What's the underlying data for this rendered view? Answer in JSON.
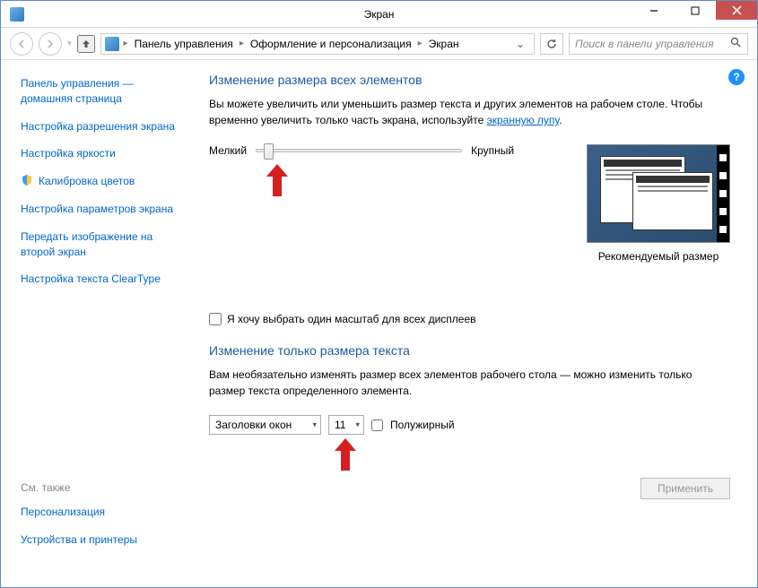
{
  "window": {
    "title": "Экран"
  },
  "breadcrumb": {
    "items": [
      "Панель управления",
      "Оформление и персонализация",
      "Экран"
    ]
  },
  "search": {
    "placeholder": "Поиск в панели управления"
  },
  "sidebar": {
    "items": [
      {
        "label": "Панель управления — домашняя страница",
        "shield": false
      },
      {
        "label": "Настройка разрешения экрана",
        "shield": false
      },
      {
        "label": "Настройка яркости",
        "shield": false
      },
      {
        "label": "Калибровка цветов",
        "shield": true
      },
      {
        "label": "Настройка параметров экрана",
        "shield": false
      },
      {
        "label": "Передать изображение на второй экран",
        "shield": false
      },
      {
        "label": "Настройка текста ClearType",
        "shield": false
      }
    ],
    "see_also_heading": "См. также",
    "see_also": [
      {
        "label": "Персонализация"
      },
      {
        "label": "Устройства и принтеры"
      }
    ]
  },
  "content": {
    "section1": {
      "heading": "Изменение размера всех элементов",
      "body_prefix": "Вы можете увеличить или уменьшить размер текста и других элементов на рабочем столе. Чтобы временно увеличить только часть экрана, используйте ",
      "body_link": "экранную лупу",
      "body_suffix": ".",
      "slider_min_label": "Мелкий",
      "slider_max_label": "Крупный",
      "preview_caption": "Рекомендуемый размер"
    },
    "checkbox_label": "Я хочу выбрать один масштаб для всех дисплеев",
    "section2": {
      "heading": "Изменение только размера текста",
      "body": "Вам необязательно изменять размер всех элементов рабочего стола — можно изменить только размер текста определенного элемента."
    },
    "element_select": "Заголовки окон",
    "size_select": "11",
    "bold_label": "Полужирный",
    "apply_button": "Применить"
  }
}
